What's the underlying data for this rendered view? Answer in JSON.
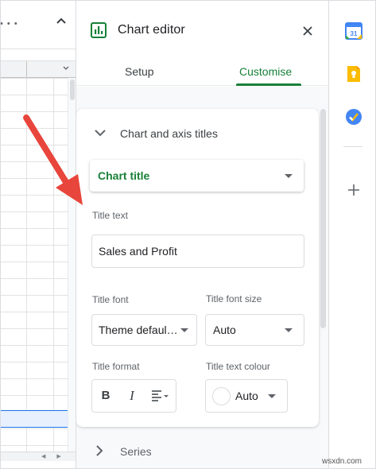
{
  "panel": {
    "title": "Chart editor",
    "tabs": [
      {
        "label": "Setup",
        "active": false
      },
      {
        "label": "Customise",
        "active": true
      }
    ]
  },
  "section": {
    "title": "Chart and axis titles",
    "selector_value": "Chart title",
    "title_text_label": "Title text",
    "title_text_value": "Sales and Profit",
    "title_font_label": "Title font",
    "title_font_value": "Theme defaul…",
    "title_font_size_label": "Title font size",
    "title_font_size_value": "Auto",
    "title_format_label": "Title format",
    "format_buttons": [
      "B",
      "I"
    ],
    "title_text_colour_label": "Title text colour",
    "title_text_colour_value": "Auto"
  },
  "next_section": {
    "title": "Series"
  },
  "side_apps": [
    "calendar-icon",
    "keep-icon",
    "tasks-icon",
    "add-icon"
  ],
  "watermark": "wsxdn.com",
  "colors": {
    "accent_green": "#188038",
    "annotation_red": "#e8453c",
    "selection_blue": "#1a73e8"
  }
}
